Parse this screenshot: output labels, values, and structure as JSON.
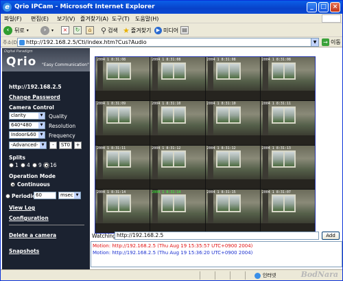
{
  "window": {
    "title": "Qrio IPCam - Microsoft Internet Explorer",
    "minimize": "_",
    "maximize": "□",
    "close": "×"
  },
  "menu": [
    "파일(F)",
    "편집(E)",
    "보기(V)",
    "즐겨찾기(A)",
    "도구(T)",
    "도움말(H)"
  ],
  "toolbar": {
    "back": "뒤로",
    "search": "검색",
    "favorites": "즐겨찾기",
    "media": "미디어"
  },
  "address": {
    "label": "주소(D)",
    "url": "http://192.168.2.5/Cti/index.htm?Cus?Audio",
    "go": "이동"
  },
  "sidebar": {
    "logo_small": "Digital Paradigm",
    "logo_main": "Qrio",
    "logo_sub": "\"Easy Communication\"",
    "host": "http://192.168.2.5",
    "change_password": "Change Password",
    "camera_control": "Camera Control",
    "quality_value": "clarity",
    "quality_label": "Quality",
    "resolution_value": "640*480",
    "resolution_label": "Resolution",
    "frequency_value": "Indoor&60",
    "frequency_label": "Frequency",
    "advanced_value": "-Advanced-",
    "minus": "-",
    "st_value": "ST0",
    "plus": "+",
    "splits_label": "Splits",
    "splits": [
      "1",
      "4",
      "9",
      "16"
    ],
    "splits_selected": "16",
    "operation_mode": "Operation Mode",
    "continuous": "Continuous",
    "periodic": "Periodic",
    "periodic_value": "60",
    "periodic_unit": "msec",
    "view_log": "View Log",
    "configuration": "Configuration",
    "delete_camera": "Delete a camera",
    "snapshots": "Snapshots"
  },
  "video": {
    "timestamps": [
      "2004 1  8:31:08",
      "2004 1  8:31:08",
      "2004 1  8:31:08",
      "2004 1  8:31:08",
      "2004 1  8:31:09",
      "2004 1  8:31:10",
      "2004 1  8:31:10",
      "2004 1  8:31:11",
      "2004 1  8:31:11",
      "2004 1  8:31:12",
      "2004 1  8:31:12",
      "2004 1  8:31:13",
      "2004 1  8:31:14",
      "2004 1  8:31:14",
      "2004 1  8:31:15",
      "2004 1  8:31:07"
    ],
    "highlight_index": 13
  },
  "watching": {
    "label": "Watching",
    "value": "http://192.168.2.5",
    "add": "Add"
  },
  "log": [
    {
      "text": "Motion: http://192.168.2.5 (Thu Aug 19 15:35:57 UTC+0900 2004)",
      "color": "#e01010"
    },
    {
      "text": "Motion: http://192.168.2.5 (Thu Aug 19 15:36:20 UTC+0900 2004)",
      "color": "#1a2fd0"
    }
  ],
  "status": {
    "zone": "인터넷"
  },
  "watermark": "BodNara"
}
